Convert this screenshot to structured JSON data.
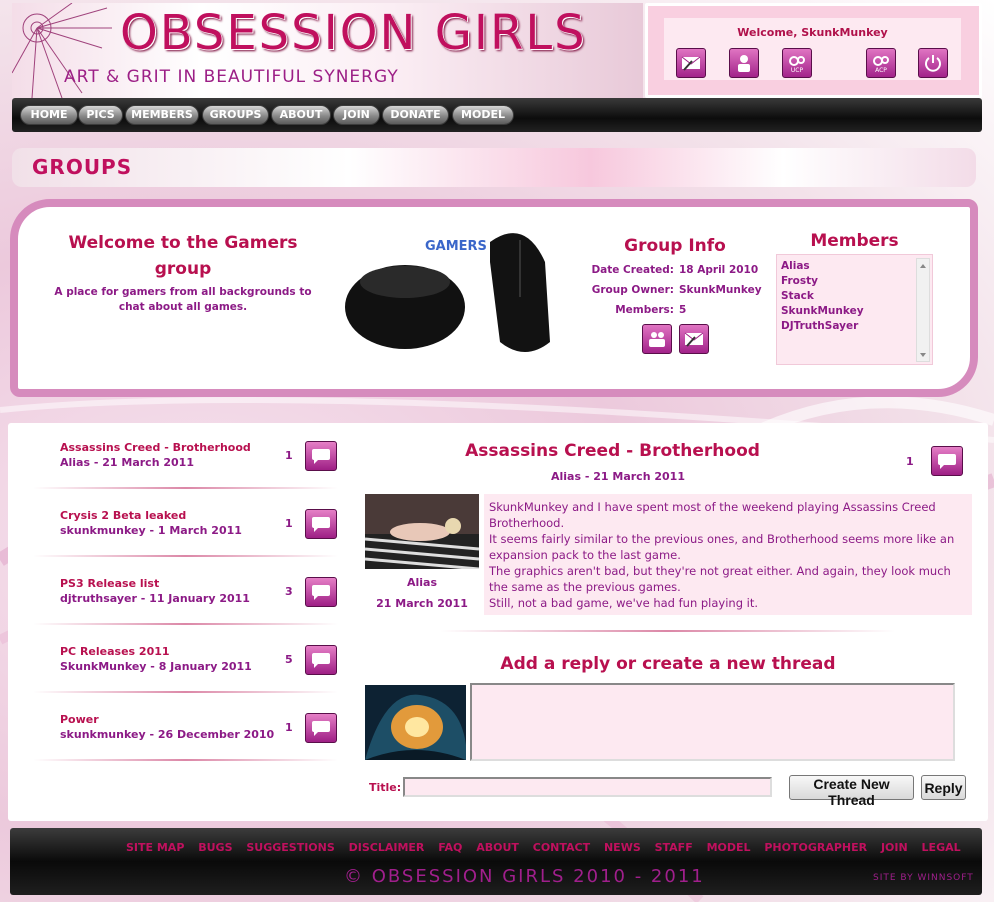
{
  "header": {
    "site_title": "OBSESSION GIRLS",
    "tagline": "ART & GRIT IN BEAUTIFUL SYNERGY",
    "nav": [
      "HOME",
      "PICS",
      "MEMBERS",
      "GROUPS",
      "ABOUT",
      "JOIN",
      "DONATE",
      "MODEL"
    ]
  },
  "user_box": {
    "welcome": "Welcome, SkunkMunkey",
    "icons": [
      {
        "name": "messages-icon",
        "label": ""
      },
      {
        "name": "profile-icon",
        "label": ""
      },
      {
        "name": "ucp-icon",
        "label": "UCP"
      },
      {
        "name": "acp-icon",
        "label": "ACP"
      },
      {
        "name": "logout-icon",
        "label": ""
      }
    ]
  },
  "page": {
    "heading": "GROUPS"
  },
  "group": {
    "welcome_title": "Welcome to the Gamers group",
    "description": "A place for gamers from all backgrounds to chat about all games.",
    "image_label": "GAMERS",
    "info_title": "Group Info",
    "date_created_label": "Date Created:",
    "date_created": "18 April 2010",
    "owner_label": "Group Owner:",
    "owner": "SkunkMunkey",
    "members_label": "Members:",
    "members_count": "5",
    "members_title": "Members",
    "members": [
      "Alias",
      "Frosty",
      "Stack",
      "SkunkMunkey",
      "DJTruthSayer"
    ]
  },
  "threads": [
    {
      "title": "Assassins Creed - Brotherhood",
      "meta": "Alias - 21 March 2011",
      "count": "1"
    },
    {
      "title": "Crysis 2 Beta leaked",
      "meta": "skunkmunkey - 1 March 2011",
      "count": "1"
    },
    {
      "title": "PS3 Release list",
      "meta": "djtruthsayer - 11 January 2011",
      "count": "3"
    },
    {
      "title": "PC Releases 2011",
      "meta": "SkunkMunkey - 8 January 2011",
      "count": "5"
    },
    {
      "title": "Power",
      "meta": "skunkmunkey - 26 December 2010",
      "count": "1"
    }
  ],
  "post": {
    "title": "Assassins Creed - Brotherhood",
    "meta": "Alias  -  21 March 2011",
    "count": "1",
    "author": "Alias",
    "date": "21 March 2011",
    "body": [
      "SkunkMunkey and I have spent most of the weekend playing Assassins Creed Brotherhood.",
      "It seems fairly similar to the previous ones, and Brotherhood seems more like an expansion pack to the last game.",
      "The graphics aren't bad, but they're not great either. And again, they look much the same as the previous games.",
      "Still, not a bad game, we've had fun playing it."
    ]
  },
  "reply": {
    "heading": "Add a reply or create a new thread",
    "title_label": "Title:",
    "create_button": "Create New Thread",
    "reply_button": "Reply"
  },
  "footer": {
    "links": [
      "SITE MAP",
      "BUGS",
      "SUGGESTIONS",
      "DISCLAIMER",
      "FAQ",
      "ABOUT",
      "CONTACT",
      "NEWS",
      "STAFF",
      "MODEL",
      "PHOTOGRAPHER",
      "JOIN",
      "LEGAL"
    ],
    "copyright": "© OBSESSION GIRLS 2010 - 2011",
    "credit": "SITE BY WINNSOFT"
  },
  "colors": {
    "accent": "#b8104f",
    "text": "#8c1a86",
    "panel": "#fde9f1"
  }
}
